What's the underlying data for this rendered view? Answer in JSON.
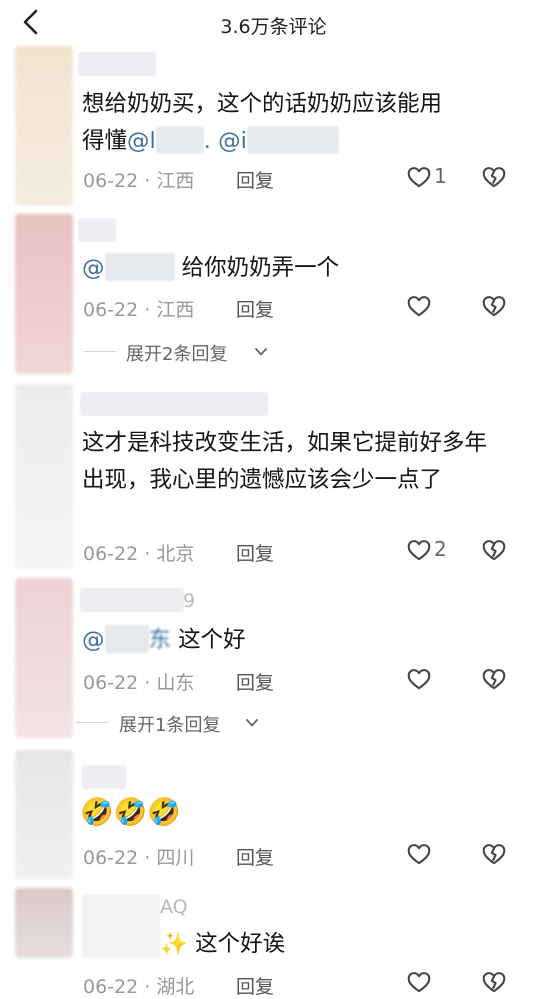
{
  "header": {
    "title": "3.6万条评论",
    "back_icon": "back-chevron-icon"
  },
  "comments": [
    {
      "text_a": "想给奶奶买，这个的话奶奶应该能用",
      "text_b": "得懂",
      "mention_1": "@l",
      "mention_sep": ". @",
      "mention_2": "i",
      "meta": "06-22 · 江西",
      "reply": "回复",
      "likes": "1"
    },
    {
      "mention": "@",
      "text": " 给你奶奶弄一个",
      "meta": "06-22 · 江西",
      "reply": "回复",
      "expand": "展开2条回复"
    },
    {
      "text": "这才是科技改变生活，如果它提前好多年出现，我心里的遗憾应该会少一点了",
      "meta": "06-22 · 北京",
      "reply": "回复",
      "likes": "2"
    },
    {
      "name_suffix": "9",
      "mention": "@",
      "mention_tail": "东",
      "text": " 这个好",
      "meta": "06-22 · 山东",
      "reply": "回复",
      "expand": "展开1条回复"
    },
    {
      "emoji": "🤣🤣🤣",
      "meta": "06-22 · 四川",
      "reply": "回复"
    },
    {
      "name_suffix": "AQ",
      "emoji": "✨",
      "text": " 这个好诶",
      "meta": "06-22 · 湖北",
      "reply": "回复"
    }
  ],
  "colors": {
    "mention": "#3f6fa1",
    "meta": "#999999",
    "text": "#141414"
  }
}
